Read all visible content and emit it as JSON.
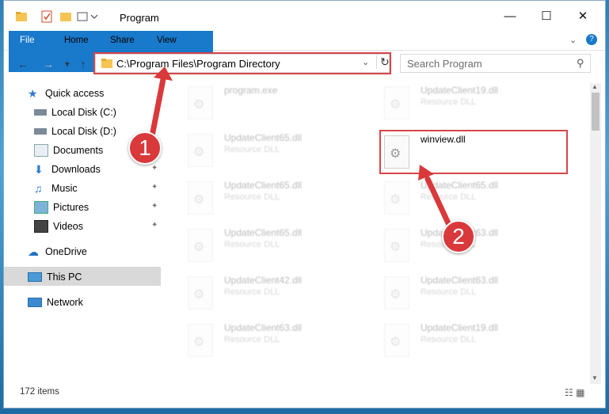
{
  "window": {
    "title": "Program"
  },
  "ribbon": {
    "tabs": [
      "File",
      "Home",
      "Share",
      "View"
    ]
  },
  "address": {
    "path": "C:\\Program Files\\Program Directory"
  },
  "search": {
    "placeholder": "Search Program"
  },
  "sidebar": {
    "quick_access": "Quick access",
    "items": [
      "Local Disk (C:)",
      "Local Disk (D:)",
      "Documents",
      "Downloads",
      "Music",
      "Pictures",
      "Videos"
    ],
    "onedrive": "OneDrive",
    "this_pc": "This PC",
    "network": "Network"
  },
  "files": {
    "left": [
      {
        "name": "program.exe",
        "type": ""
      },
      {
        "name": "UpdateClient65.dll",
        "type": "Resource DLL"
      },
      {
        "name": "UpdateClient65.dll",
        "type": "Resource DLL"
      },
      {
        "name": "UpdateClient65.dll",
        "type": "Resource DLL"
      },
      {
        "name": "UpdateClient42.dll",
        "type": "Resource DLL"
      },
      {
        "name": "UpdateClient63.dll",
        "type": "Resource DLL"
      }
    ],
    "right": [
      {
        "name": "UpdateClient19.dll",
        "type": "Resource DLL"
      },
      {
        "name": "winview.dll",
        "type": ""
      },
      {
        "name": "UpdateClient65.dll",
        "type": "Resource DLL"
      },
      {
        "name": "UpdateClient63.dll",
        "type": "Resource DLL"
      },
      {
        "name": "UpdateClient63.dll",
        "type": "Resource DLL"
      },
      {
        "name": "UpdateClient19.dll",
        "type": "Resource DLL"
      }
    ]
  },
  "status": {
    "count": "172 items"
  },
  "annotations": {
    "step1": "1",
    "step2": "2"
  },
  "colors": {
    "accent": "#1979ca",
    "highlight": "#d6454a"
  }
}
